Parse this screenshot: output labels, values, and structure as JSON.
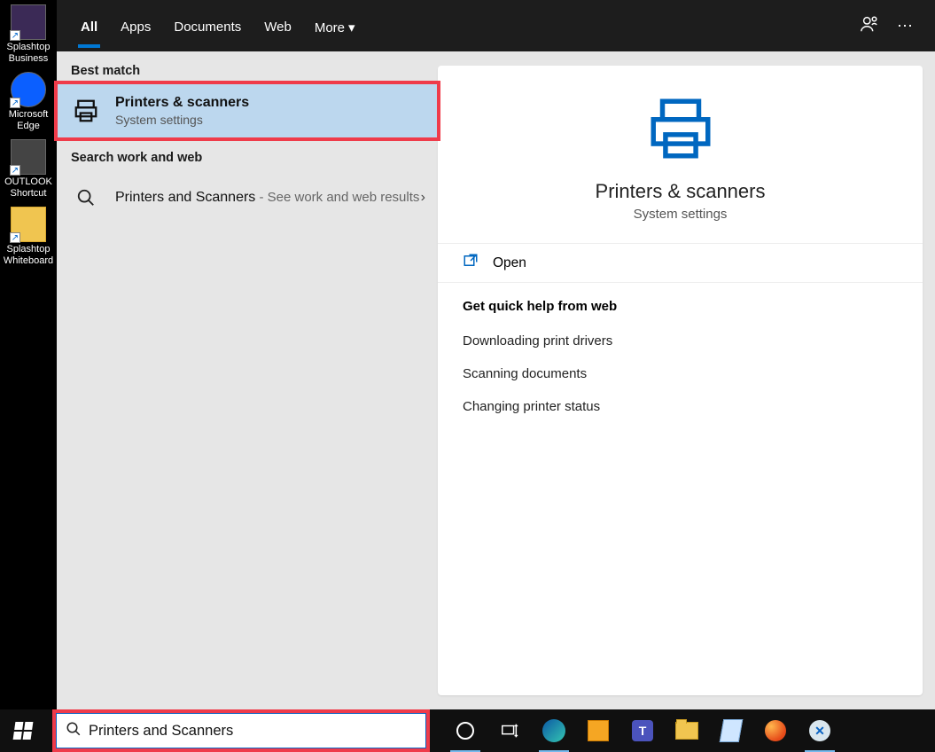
{
  "desktop_icons": [
    {
      "name": "splashtop-business",
      "label": "Splashtop Business",
      "glyph": "S",
      "cls": "purple"
    },
    {
      "name": "microsoft-edge",
      "label": "Microsoft Edge",
      "glyph": "e",
      "cls": "edge"
    },
    {
      "name": "outlook-shortcut",
      "label": "OUTLOOK Shortcut",
      "glyph": "O",
      "cls": ""
    },
    {
      "name": "splashtop-whiteboard",
      "label": "Splashtop Whiteboard",
      "glyph": "",
      "cls": "folder"
    }
  ],
  "tabs": {
    "all": "All",
    "apps": "Apps",
    "documents": "Documents",
    "web": "Web",
    "more": "More"
  },
  "left": {
    "best_match": "Best match",
    "item1_title": "Printers & scanners",
    "item1_sub": "System settings",
    "search_section": "Search work and web",
    "item2_title": "Printers and Scanners",
    "item2_suffix": " - See work and web results"
  },
  "detail": {
    "title": "Printers & scanners",
    "sub": "System settings",
    "open": "Open",
    "help_header": "Get quick help from web",
    "links": [
      "Downloading print drivers",
      "Scanning documents",
      "Changing printer status"
    ]
  },
  "search_value": "Printers and Scanners"
}
